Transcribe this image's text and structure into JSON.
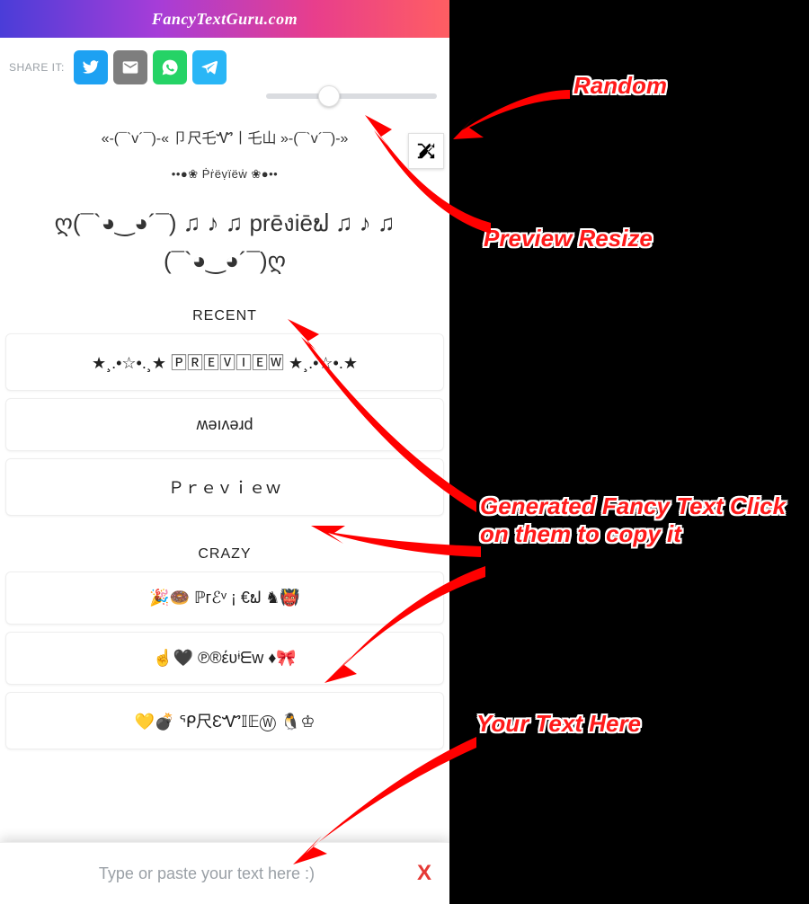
{
  "header": {
    "title": "FancyTextGuru.com"
  },
  "share": {
    "label": "SHARE IT:",
    "buttons": [
      {
        "name": "twitter",
        "icon": "twitter-icon"
      },
      {
        "name": "email",
        "icon": "email-icon"
      },
      {
        "name": "whatsapp",
        "icon": "whatsapp-icon"
      },
      {
        "name": "telegram",
        "icon": "telegram-icon"
      }
    ]
  },
  "slider": {
    "value": 35,
    "min": 0,
    "max": 100
  },
  "random": {
    "glyph": "✕",
    "title": "Random"
  },
  "preview": {
    "line1": "«-(¯`v´¯)-« 卩尺乇Ꮙ丨乇山 »-(¯`v´¯)-»",
    "line2": "••●❀ Ṗṙëṿïëẇ ❀●••",
    "line3": "ღ(¯`◕‿◕´¯) ♫ ♪ ♫ prēงiēຟ ♫ ♪ ♫ (¯`◕‿◕´¯)ღ"
  },
  "sections": {
    "recent": {
      "title": "RECENT",
      "items": [
        "★¸.•☆•.¸★ 🄿🅁🄴🅅🄸🄴🅆 ★¸.•☆•.★",
        "ʍǝıʌǝɹd",
        "Ｐｒｅｖｉｅｗ"
      ]
    },
    "crazy": {
      "title": "CRAZY",
      "items": [
        "🎉🍩 ℙгℰᵛ ¡ €ຟ ♞👹",
        "☝🖤 ℗®έʋᶤᗴw ♦🎀",
        "💛💣 ᕿ尺ƐᏉ𝕀𝔼Ⓦ 🐧♔"
      ]
    }
  },
  "input": {
    "placeholder": "Type or paste your text here :)",
    "clear": "X"
  },
  "annotations": {
    "random": "Random",
    "resize": "Preview Resize",
    "generated": "Generated Fancy Text Click on them to copy it",
    "yourtext": "Your Text Here"
  }
}
